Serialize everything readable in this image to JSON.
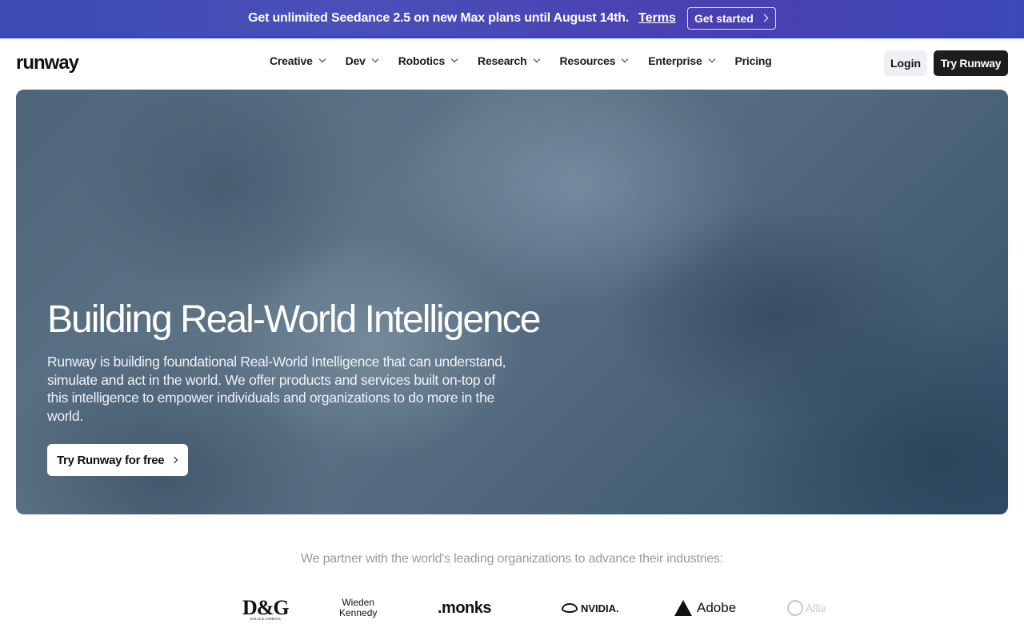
{
  "promo": {
    "text": "Get unlimited Seedance 2.5 on new Max plans until August 14th.",
    "terms_label": "Terms",
    "cta_label": "Get started",
    "bg_color": "#3f4ab4"
  },
  "nav": {
    "logo": "runway",
    "menu": [
      {
        "label": "Creative",
        "has_dropdown": true
      },
      {
        "label": "Dev",
        "has_dropdown": true
      },
      {
        "label": "Robotics",
        "has_dropdown": true
      },
      {
        "label": "Research",
        "has_dropdown": true
      },
      {
        "label": "Resources",
        "has_dropdown": true
      },
      {
        "label": "Enterprise",
        "has_dropdown": true
      },
      {
        "label": "Pricing",
        "has_dropdown": false
      }
    ],
    "login_label": "Login",
    "try_label": "Try Runway"
  },
  "hero": {
    "title": "Building Real-World Intelligence",
    "description": "Runway is building foundational Real-World Intelligence that can understand, simulate and act in the world. We offer products and services built on-top of this intelligence to empower individuals and organizations to do more in the world.",
    "cta_label": "Try Runway for free"
  },
  "partners": {
    "text": "We partner with the world's leading organizations to advance their industries:",
    "logos": {
      "dg": {
        "main": "D&G",
        "sub": "DOLCE & GABBANA"
      },
      "wk": {
        "line1": "Wieden",
        "line2": "Kennedy"
      },
      "monks": ".monks",
      "nvidia": "NVIDIA.",
      "adobe": "Adobe",
      "allianz": "Allianz"
    }
  }
}
